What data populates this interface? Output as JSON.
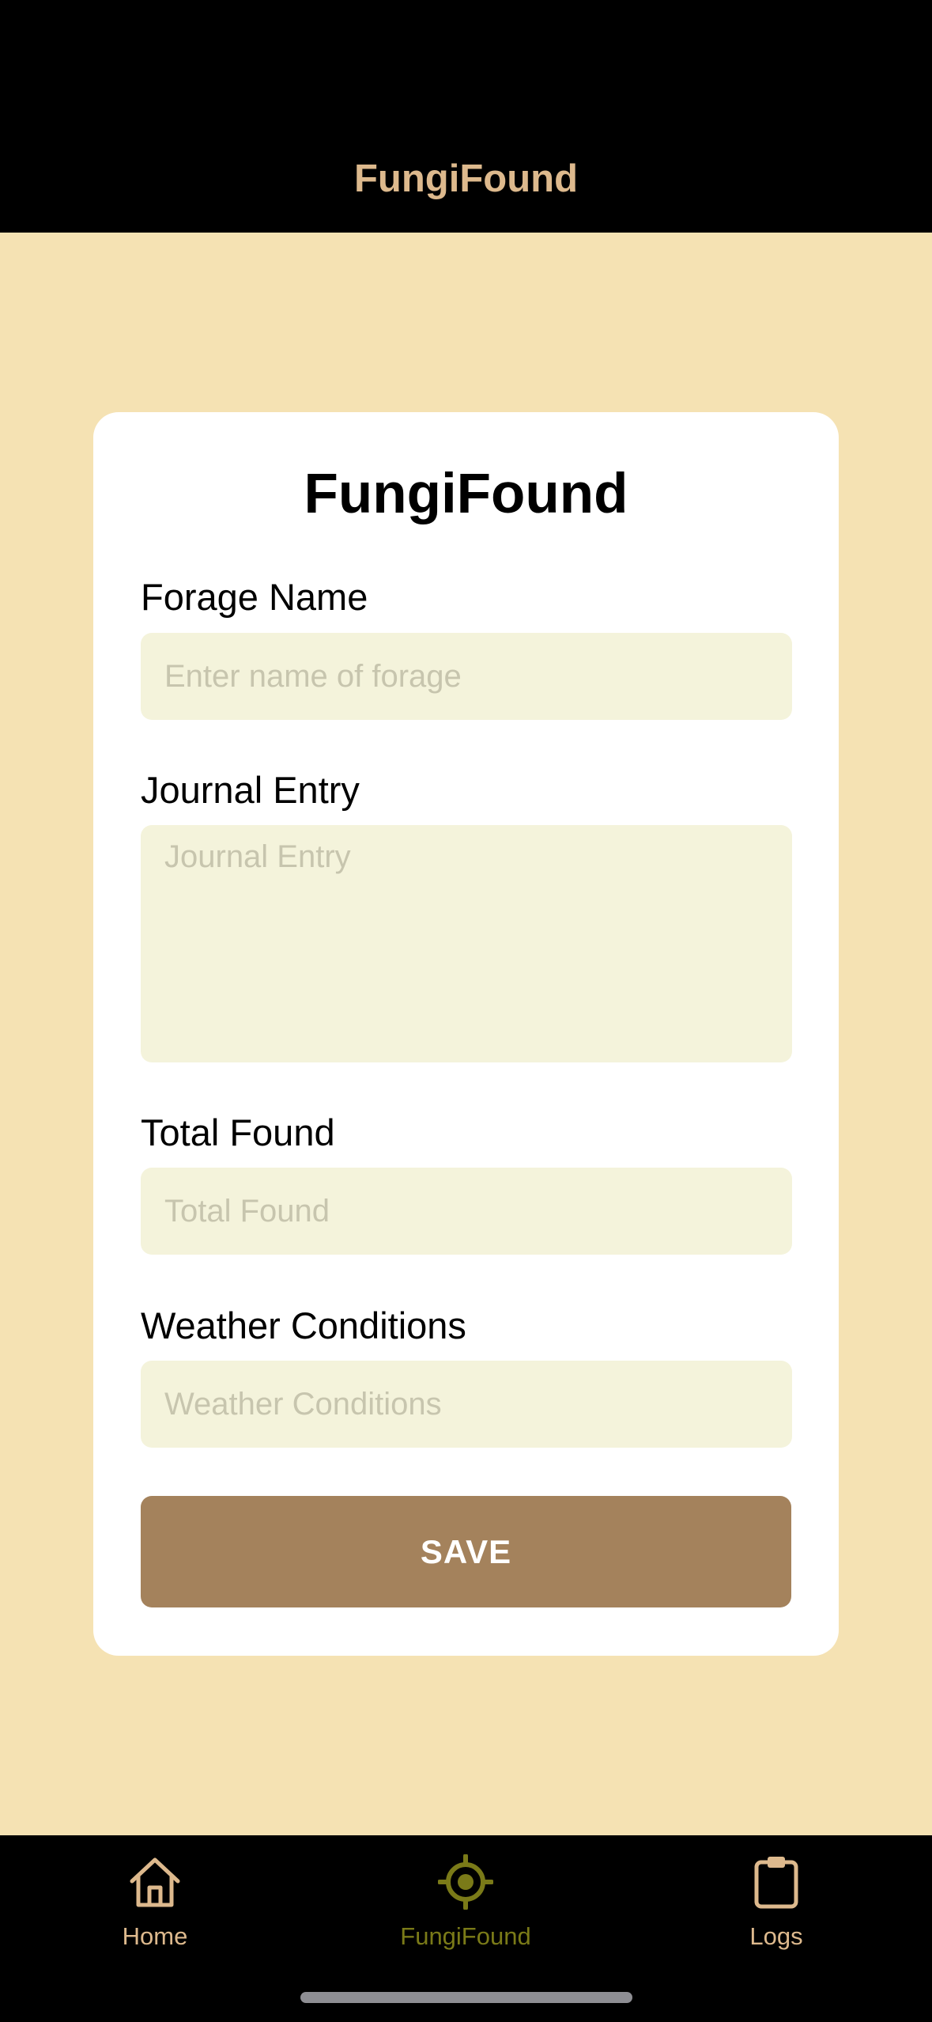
{
  "header": {
    "title": "FungiFound"
  },
  "form": {
    "title": "FungiFound",
    "fields": [
      {
        "label": "Forage Name",
        "placeholder": "Enter name of forage",
        "value": ""
      },
      {
        "label": "Journal Entry",
        "placeholder": "Journal Entry",
        "value": ""
      },
      {
        "label": "Total Found",
        "placeholder": "Total Found",
        "value": ""
      },
      {
        "label": "Weather Conditions",
        "placeholder": "Weather Conditions",
        "value": ""
      }
    ],
    "save_label": "SAVE"
  },
  "tabs": [
    {
      "label": "Home",
      "icon": "home-icon",
      "active": false
    },
    {
      "label": "FungiFound",
      "icon": "crosshair-icon",
      "active": true
    },
    {
      "label": "Logs",
      "icon": "clipboard-icon",
      "active": false
    }
  ],
  "colors": {
    "background": "#F5E2B3",
    "header": "#000000",
    "header_title": "#DDB98D",
    "card": "#FFFFFF",
    "input_bg": "#F4F3DB",
    "button": "#A4825C",
    "tab_active": "#7A7A18",
    "tab_inactive": "#DDB98D"
  }
}
